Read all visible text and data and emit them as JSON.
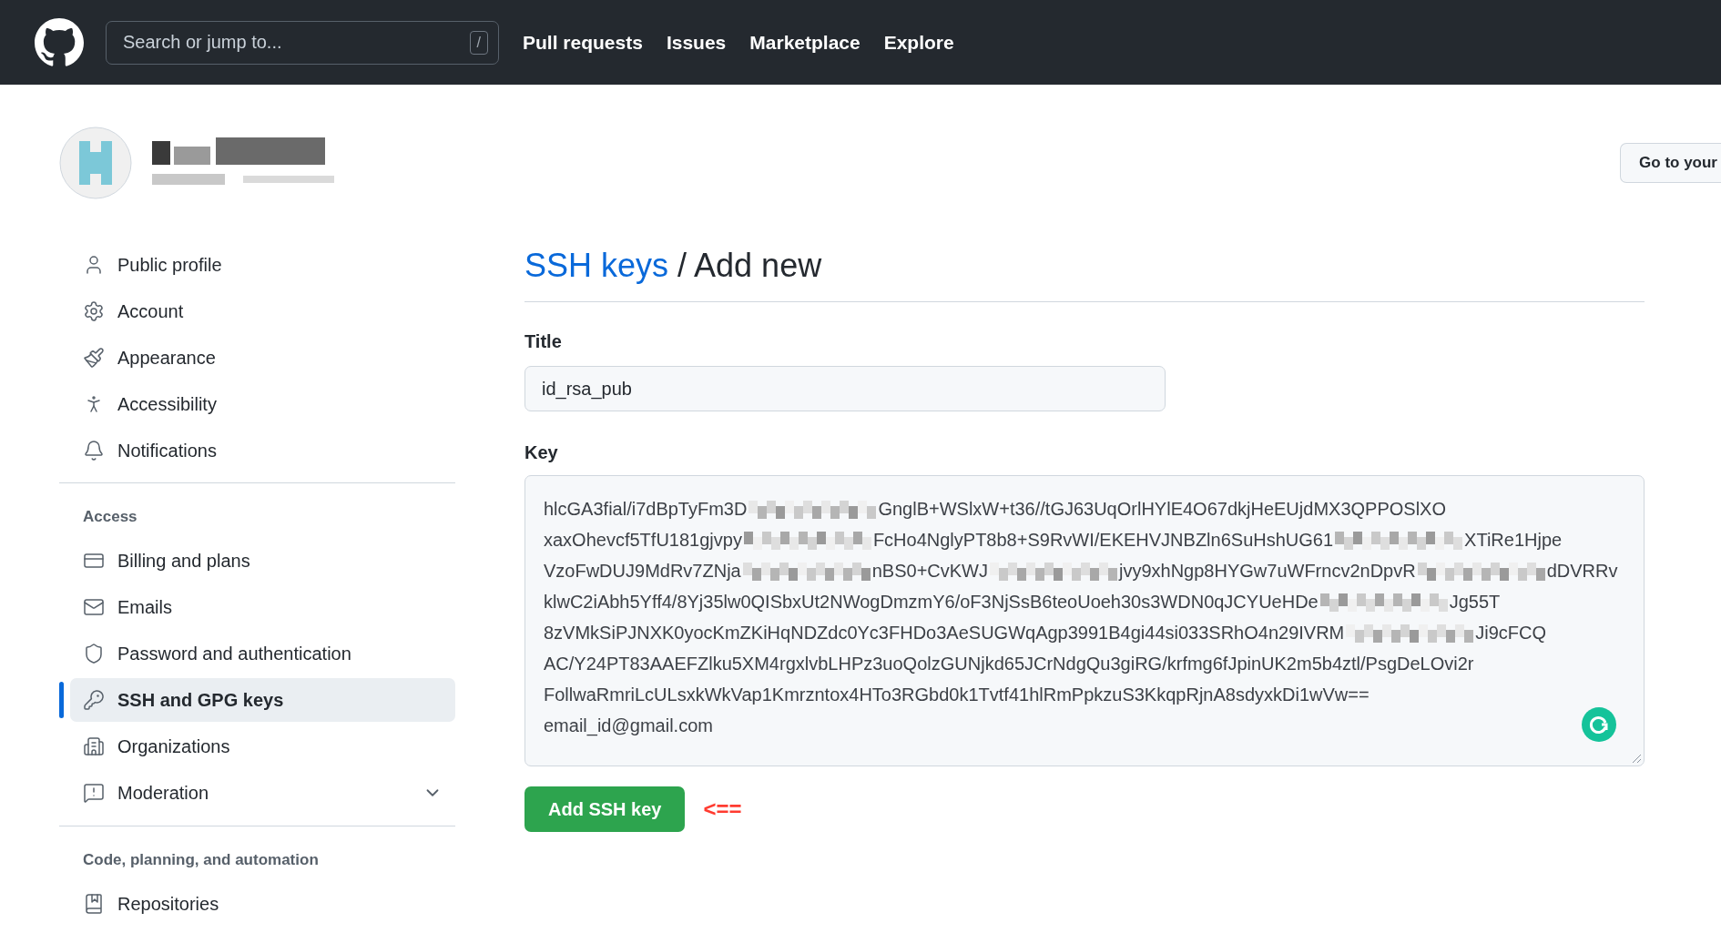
{
  "header": {
    "search": {
      "placeholder": "Search or jump to...",
      "shortcut": "/"
    },
    "nav": [
      "Pull requests",
      "Issues",
      "Marketplace",
      "Explore"
    ]
  },
  "profile": {
    "go_button": "Go to your"
  },
  "sidebar": {
    "sections": [
      {
        "items": [
          {
            "label": "Public profile",
            "selected": false,
            "kind": "link"
          },
          {
            "label": "Account",
            "selected": false,
            "kind": "link"
          },
          {
            "label": "Appearance",
            "selected": false,
            "kind": "link"
          },
          {
            "label": "Accessibility",
            "selected": false,
            "kind": "link"
          },
          {
            "label": "Notifications",
            "selected": false,
            "kind": "link"
          }
        ]
      },
      {
        "heading": "Access",
        "items": [
          {
            "label": "Billing and plans",
            "selected": false,
            "kind": "link"
          },
          {
            "label": "Emails",
            "selected": false,
            "kind": "link"
          },
          {
            "label": "Password and authentication",
            "selected": false,
            "kind": "link"
          },
          {
            "label": "SSH and GPG keys",
            "selected": true,
            "kind": "link"
          },
          {
            "label": "Organizations",
            "selected": false,
            "kind": "link"
          },
          {
            "label": "Moderation",
            "selected": false,
            "kind": "collapsible"
          }
        ]
      },
      {
        "heading": "Code, planning, and automation",
        "items": [
          {
            "label": "Repositories",
            "selected": false,
            "kind": "link"
          }
        ]
      }
    ]
  },
  "main": {
    "breadcrumb_link": "SSH keys",
    "title": "/ Add new",
    "title_field": {
      "label": "Title",
      "value": "id_rsa_pub"
    },
    "key_field": {
      "label": "Key",
      "lines": [
        {
          "segments": [
            {
              "kind": "text",
              "text": "hlcGA3fial/i7dBpTyFm3D"
            },
            {
              "kind": "redacted"
            },
            {
              "kind": "text",
              "text": "GnglB+WSlxW+t36//tGJ63UqOrlHYlE4O67dkjHeEUjdMX3QPPOSlXO"
            }
          ]
        },
        {
          "segments": [
            {
              "kind": "text",
              "text": "xaxOhevcf5TfU181gjvpy"
            },
            {
              "kind": "redacted"
            },
            {
              "kind": "text",
              "text": "FcHo4NglyPT8b8+S9RvWI/EKEHVJNBZln6SuHshUG61"
            },
            {
              "kind": "redacted"
            },
            {
              "kind": "text",
              "text": "XTiRe1Hjpe"
            }
          ]
        },
        {
          "segments": [
            {
              "kind": "text",
              "text": "VzoFwDUJ9MdRv7ZNja"
            },
            {
              "kind": "redacted"
            },
            {
              "kind": "text",
              "text": "nBS0+CvKWJ"
            },
            {
              "kind": "redacted"
            },
            {
              "kind": "text",
              "text": "jvy9xhNgp8HYGw7uWFrncv2nDpvR"
            },
            {
              "kind": "redacted"
            },
            {
              "kind": "text",
              "text": "dDVRRv"
            }
          ]
        },
        {
          "segments": [
            {
              "kind": "text",
              "text": "klwC2iAbh5Yff4/8Yj35lw0QISbxUt2NWogDmzmY6/oF3NjSsB6teoUoeh30s3WDN0qJCYUeHDe"
            },
            {
              "kind": "redacted"
            },
            {
              "kind": "text",
              "text": "Jg55T"
            }
          ]
        },
        {
          "segments": [
            {
              "kind": "text",
              "text": "8zVMkSiPJNXK0yocKmZKiHqNDZdc0Yc3FHDo3AeSUGWqAgp3991B4gi44si033SRhO4n29IVRM"
            },
            {
              "kind": "redacted"
            },
            {
              "kind": "text",
              "text": "Ji9cFCQ"
            }
          ]
        },
        {
          "segments": [
            {
              "kind": "text",
              "text": "AC/Y24PT83AAEFZlku5XM4rgxlvbLHPz3uoQolzGUNjkd65JCrNdgQu3giRG/krfmg6fJpinUK2m5b4ztl/PsgDeLOvi2r"
            }
          ]
        },
        {
          "segments": [
            {
              "kind": "text",
              "text": "FollwaRmriLcULsxkWkVap1Kmrzntox4HTo3RGbd0k1Tvtf41hlRmPpkzuS3KkqpRjnA8sdyxkDi1wVw=="
            }
          ]
        },
        {
          "segments": [
            {
              "kind": "text",
              "text": "email_id@gmail.com"
            }
          ]
        }
      ]
    },
    "submit": "Add SSH key",
    "annotation": "<=="
  }
}
